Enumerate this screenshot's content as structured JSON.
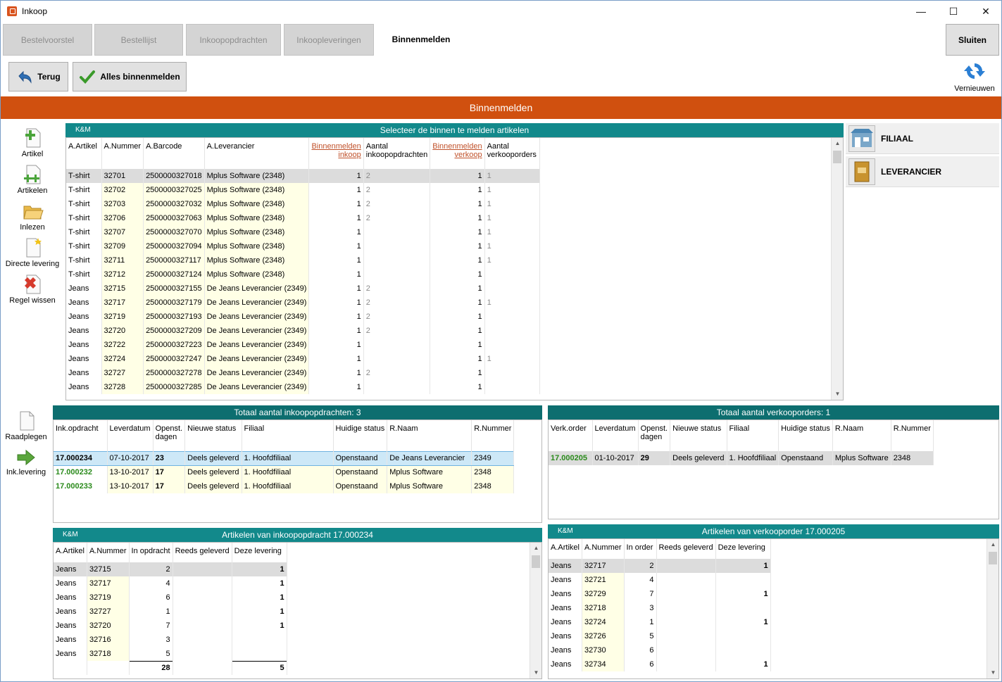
{
  "window": {
    "title": "Inkoop",
    "minimize": "—",
    "maximize": "☐",
    "close": "✕"
  },
  "tabs": [
    "Bestelvoorstel",
    "Bestellijst",
    "Inkoopopdrachten",
    "Inkoopleveringen",
    "Binnenmelden"
  ],
  "close_button": "Sluiten",
  "toolbar": {
    "back": "Terug",
    "receive_all": "Alles binnenmelden",
    "refresh": "Vernieuwen"
  },
  "band_title": "Binnenmelden",
  "side_top": [
    "Artikel",
    "Artikelen",
    "Inlezen",
    "Directe levering",
    "Regel wissen"
  ],
  "side_bottom": [
    "Raadplegen",
    "Ink.levering"
  ],
  "right_buttons": [
    "FILIAAL",
    "LEVERANCIER"
  ],
  "main_grid": {
    "tag": "K&M",
    "title": "Selecteer de binnen te melden artikelen",
    "headers": [
      "A.Artikel",
      "A.Nummer",
      "A.Barcode",
      "A.Leverancier",
      "Binnenmelden inkoop",
      "Aantal inkoopopdrachten",
      "Binnenmelden verkoop",
      "Aantal verkooporders"
    ],
    "header_lines": [
      [
        "A.Artikel"
      ],
      [
        "A.Nummer"
      ],
      [
        "A.Barcode"
      ],
      [
        "A.Leverancier"
      ],
      [
        "Binnenmelden",
        "inkoop"
      ],
      [
        "Aantal",
        "inkoopopdrachten"
      ],
      [
        "Binnenmelden",
        "verkoop"
      ],
      [
        "Aantal",
        "verkooporders"
      ]
    ],
    "rows": [
      [
        "T-shirt",
        "32701",
        "2500000327018",
        "Mplus Software (2348)",
        "1",
        "2",
        "1",
        "1"
      ],
      [
        "T-shirt",
        "32702",
        "2500000327025",
        "Mplus Software (2348)",
        "1",
        "2",
        "1",
        "1"
      ],
      [
        "T-shirt",
        "32703",
        "2500000327032",
        "Mplus Software (2348)",
        "1",
        "2",
        "1",
        "1"
      ],
      [
        "T-shirt",
        "32706",
        "2500000327063",
        "Mplus Software (2348)",
        "1",
        "2",
        "1",
        "1"
      ],
      [
        "T-shirt",
        "32707",
        "2500000327070",
        "Mplus Software (2348)",
        "1",
        "",
        "1",
        "1"
      ],
      [
        "T-shirt",
        "32709",
        "2500000327094",
        "Mplus Software (2348)",
        "1",
        "",
        "1",
        "1"
      ],
      [
        "T-shirt",
        "32711",
        "2500000327117",
        "Mplus Software (2348)",
        "1",
        "",
        "1",
        "1"
      ],
      [
        "T-shirt",
        "32712",
        "2500000327124",
        "Mplus Software (2348)",
        "1",
        "",
        "1",
        ""
      ],
      [
        "Jeans",
        "32715",
        "2500000327155",
        "De Jeans Leverancier (2349)",
        "1",
        "2",
        "1",
        ""
      ],
      [
        "Jeans",
        "32717",
        "2500000327179",
        "De Jeans Leverancier (2349)",
        "1",
        "2",
        "1",
        "1"
      ],
      [
        "Jeans",
        "32719",
        "2500000327193",
        "De Jeans Leverancier (2349)",
        "1",
        "2",
        "1",
        ""
      ],
      [
        "Jeans",
        "32720",
        "2500000327209",
        "De Jeans Leverancier (2349)",
        "1",
        "2",
        "1",
        ""
      ],
      [
        "Jeans",
        "32722",
        "2500000327223",
        "De Jeans Leverancier (2349)",
        "1",
        "",
        "1",
        ""
      ],
      [
        "Jeans",
        "32724",
        "2500000327247",
        "De Jeans Leverancier (2349)",
        "1",
        "",
        "1",
        "1"
      ],
      [
        "Jeans",
        "32727",
        "2500000327278",
        "De Jeans Leverancier (2349)",
        "1",
        "2",
        "1",
        ""
      ],
      [
        "Jeans",
        "32728",
        "2500000327285",
        "De Jeans Leverancier (2349)",
        "1",
        "",
        "1",
        ""
      ]
    ]
  },
  "purchase_orders": {
    "title": "Totaal aantal inkoopopdrachten: 3",
    "header_lines": [
      [
        "Ink.opdracht"
      ],
      [
        "Leverdatum"
      ],
      [
        "Openst.",
        "dagen"
      ],
      [
        "Nieuwe status"
      ],
      [
        "Filiaal"
      ],
      [
        "Huidige status"
      ],
      [
        "R.Naam"
      ],
      [
        "R.Nummer"
      ]
    ],
    "rows": [
      [
        "17.000234",
        "07-10-2017",
        "23",
        "Deels geleverd",
        "1. Hoofdfiliaal",
        "Openstaand",
        "De Jeans Leverancier",
        "2349"
      ],
      [
        "17.000232",
        "13-10-2017",
        "17",
        "Deels geleverd",
        "1. Hoofdfiliaal",
        "Openstaand",
        "Mplus Software",
        "2348"
      ],
      [
        "17.000233",
        "13-10-2017",
        "17",
        "Deels geleverd",
        "1. Hoofdfiliaal",
        "Openstaand",
        "Mplus Software",
        "2348"
      ]
    ]
  },
  "sales_orders": {
    "title": "Totaal aantal verkooporders: 1",
    "header_lines": [
      [
        "Verk.order"
      ],
      [
        "Leverdatum"
      ],
      [
        "Openst.",
        "dagen"
      ],
      [
        "Nieuwe status"
      ],
      [
        "Filiaal"
      ],
      [
        "Huidige status"
      ],
      [
        "R.Naam"
      ],
      [
        "R.Nummer"
      ]
    ],
    "rows": [
      [
        "17.000205",
        "01-10-2017",
        "29",
        "Deels geleverd",
        "1. Hoofdfiliaal",
        "Openstaand",
        "Mplus Software",
        "2348"
      ]
    ]
  },
  "po_articles": {
    "tag": "K&M",
    "title": "Artikelen van inkoopopdracht 17.000234",
    "headers": [
      "A.Artikel",
      "A.Nummer",
      "In opdracht",
      "Reeds geleverd",
      "Deze levering"
    ],
    "rows": [
      [
        "Jeans",
        "32715",
        "2",
        "",
        "1"
      ],
      [
        "Jeans",
        "32717",
        "4",
        "",
        "1"
      ],
      [
        "Jeans",
        "32719",
        "6",
        "",
        "1"
      ],
      [
        "Jeans",
        "32727",
        "1",
        "",
        "1"
      ],
      [
        "Jeans",
        "32720",
        "7",
        "",
        "1"
      ],
      [
        "Jeans",
        "32716",
        "3",
        "",
        ""
      ],
      [
        "Jeans",
        "32718",
        "5",
        "",
        ""
      ]
    ],
    "totals": [
      "28",
      "5"
    ]
  },
  "so_articles": {
    "tag": "K&M",
    "title": "Artikelen van verkooporder 17.000205",
    "headers": [
      "A.Artikel",
      "A.Nummer",
      "In order",
      "Reeds geleverd",
      "Deze levering"
    ],
    "rows": [
      [
        "Jeans",
        "32717",
        "2",
        "",
        "1"
      ],
      [
        "Jeans",
        "32721",
        "4",
        "",
        ""
      ],
      [
        "Jeans",
        "32729",
        "7",
        "",
        "1"
      ],
      [
        "Jeans",
        "32718",
        "3",
        "",
        ""
      ],
      [
        "Jeans",
        "32724",
        "1",
        "",
        "1"
      ],
      [
        "Jeans",
        "32726",
        "5",
        "",
        ""
      ],
      [
        "Jeans",
        "32730",
        "6",
        "",
        ""
      ],
      [
        "Jeans",
        "32734",
        "6",
        "",
        "1"
      ]
    ]
  },
  "colors": {
    "accent": "#d0500f",
    "header_teal": "#12898b",
    "dark_teal": "#0d6e6f",
    "link": "#c0512a",
    "green": "#2a8a1b"
  }
}
